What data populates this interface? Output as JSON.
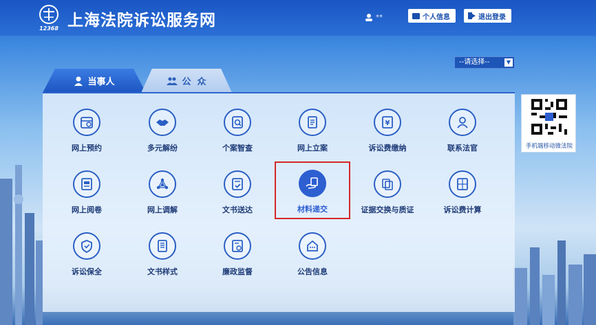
{
  "header": {
    "site_title": "上海法院诉讼服务网",
    "logo_badge": "12368",
    "user_name": "**",
    "profile_button": "个人信息",
    "logout_button": "退出登录"
  },
  "select": {
    "selected": "--请选择--"
  },
  "tabs": [
    {
      "label": "当事人",
      "active": true
    },
    {
      "label": "公  众",
      "active": false
    }
  ],
  "services": [
    {
      "label": "网上预约",
      "icon": "calendar-icon"
    },
    {
      "label": "多元解纷",
      "icon": "handshake-icon"
    },
    {
      "label": "个案智查",
      "icon": "search-doc-icon"
    },
    {
      "label": "网上立案",
      "icon": "file-edit-icon"
    },
    {
      "label": "诉讼费缴纳",
      "icon": "fee-payment-icon"
    },
    {
      "label": "联系法官",
      "icon": "judge-icon"
    },
    {
      "label": "网上阅卷",
      "icon": "file-read-icon"
    },
    {
      "label": "网上调解",
      "icon": "network-icon"
    },
    {
      "label": "文书送达",
      "icon": "document-check-icon"
    },
    {
      "label": "材料递交",
      "icon": "hand-document-icon",
      "active": true
    },
    {
      "label": "证据交换与质证",
      "icon": "evidence-exchange-icon"
    },
    {
      "label": "诉讼费计算",
      "icon": "calculator-icon"
    },
    {
      "label": "诉讼保全",
      "icon": "shield-icon"
    },
    {
      "label": "文书样式",
      "icon": "document-template-icon"
    },
    {
      "label": "廉政监督",
      "icon": "integrity-supervision-icon"
    },
    {
      "label": "公告信息",
      "icon": "notice-box-icon"
    }
  ],
  "qr": {
    "label": "手机端移动微法院",
    "icon": "qr-code-icon"
  },
  "colors": {
    "primary": "#2d5fd1",
    "highlight_border": "#d4262a",
    "header": "#1a56c4"
  }
}
